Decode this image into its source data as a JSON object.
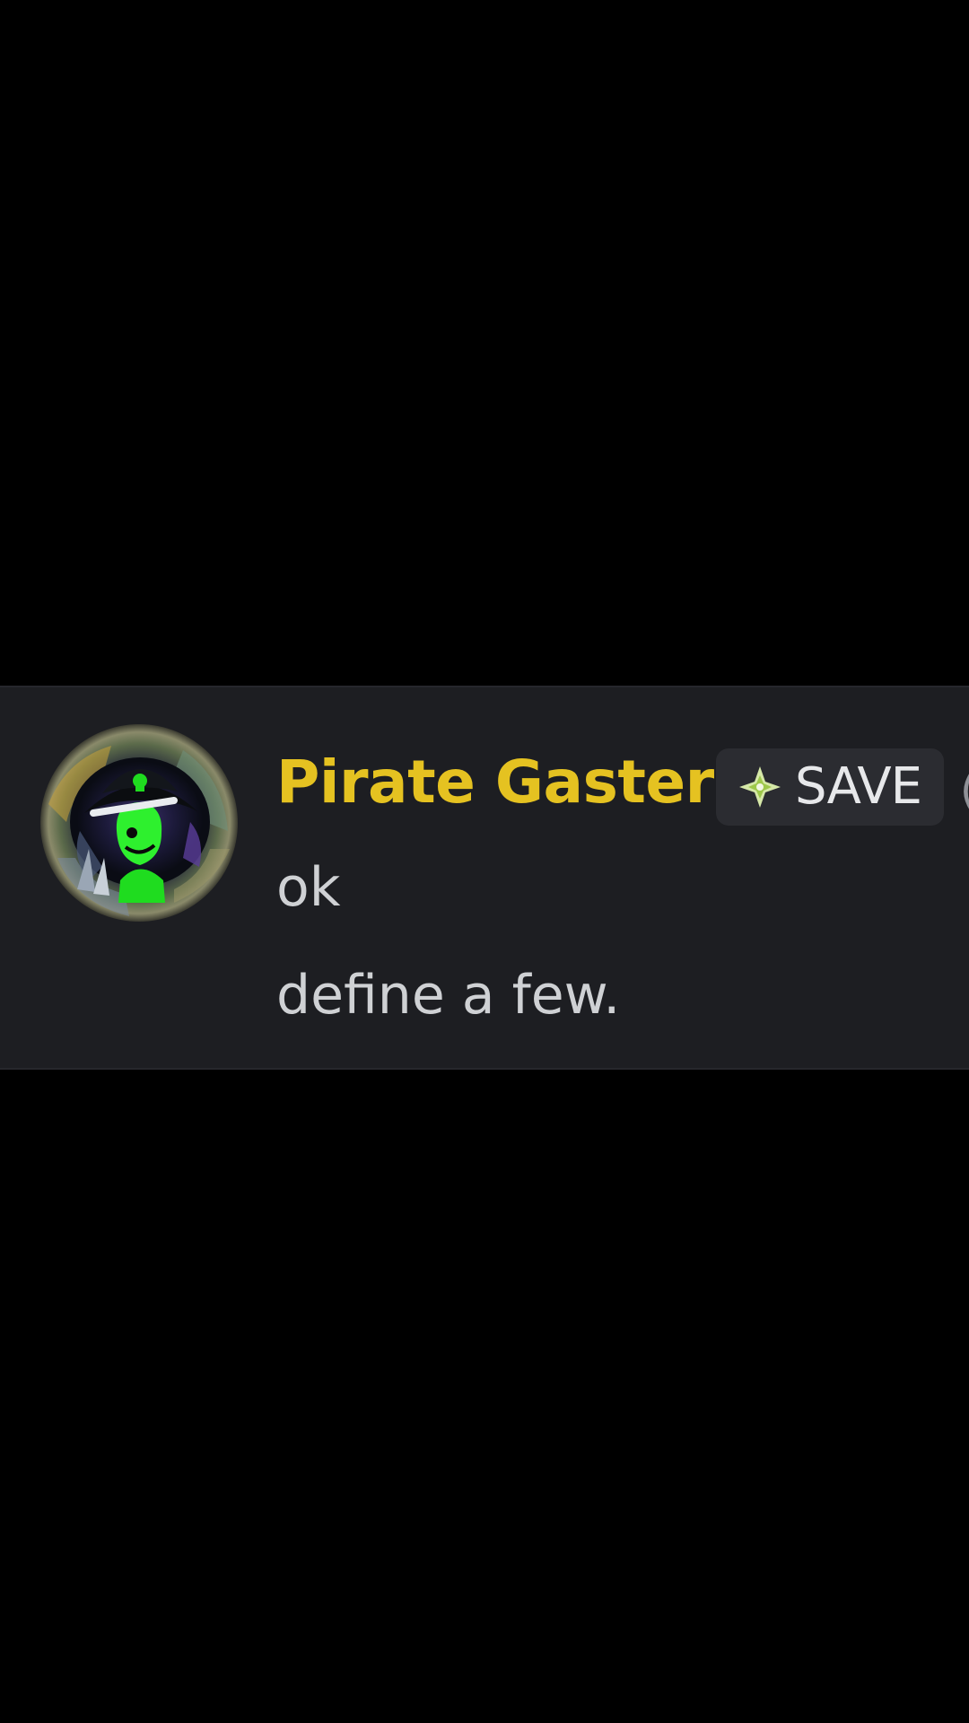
{
  "message": {
    "author": {
      "name": "Pirate Gaster",
      "name_color": "#e5c221"
    },
    "tag": {
      "icon": "sparkle-diamond-icon",
      "label": "SAVE"
    },
    "lines": [
      "ok",
      "define a few."
    ]
  },
  "colors": {
    "background": "#000000",
    "panel": "#1d1e22",
    "badge": "#2b2c31",
    "text": "#cfd1d4"
  }
}
